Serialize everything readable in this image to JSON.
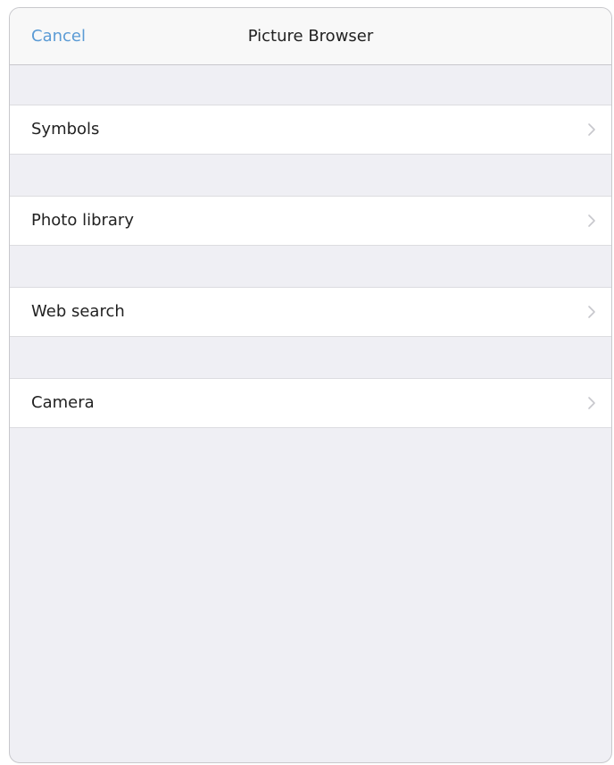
{
  "navbar": {
    "cancel_label": "Cancel",
    "title": "Picture Browser"
  },
  "menu": {
    "items": [
      {
        "label": "Symbols"
      },
      {
        "label": "Photo library"
      },
      {
        "label": "Web search"
      },
      {
        "label": "Camera"
      }
    ]
  },
  "colors": {
    "accent": "#5b9bd5",
    "background": "#efeff4",
    "row_background": "#ffffff",
    "chevron": "#c7c7cc"
  },
  "icons": {
    "row_disclosure": "chevron-right-icon"
  }
}
